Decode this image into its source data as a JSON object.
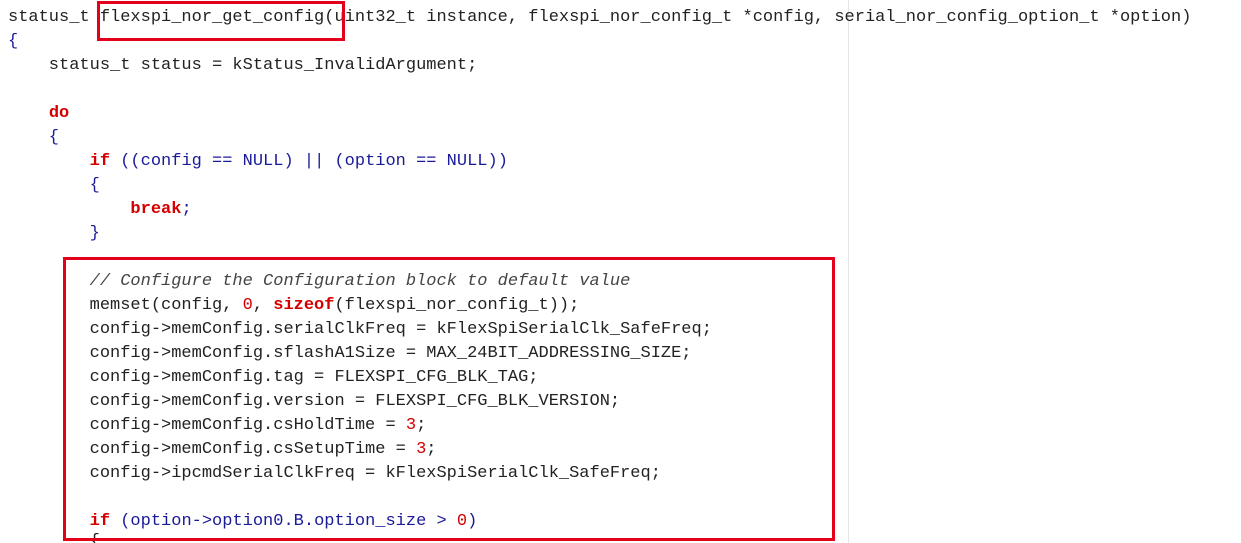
{
  "editor": {
    "clipped_top_line": "// ...",
    "clipped_bottom_line": "        {",
    "lines": [
      [
        {
          "t": "status_t flexspi_nor_get_config(uint32_t instance, flexspi_nor_config_t *config, serial_nor_config_option_t *option)",
          "c": "pl"
        }
      ],
      [
        {
          "t": "{",
          "c": "op"
        }
      ],
      [
        {
          "t": "    status_t status = kStatus_InvalidArgument;",
          "c": "pl"
        }
      ],
      [],
      [
        {
          "t": "    ",
          "c": "pl"
        },
        {
          "t": "do",
          "c": "kw"
        }
      ],
      [
        {
          "t": "    {",
          "c": "op"
        }
      ],
      [
        {
          "t": "        ",
          "c": "pl"
        },
        {
          "t": "if",
          "c": "kw"
        },
        {
          "t": " ((config == NULL) || (option == NULL))",
          "c": "op"
        }
      ],
      [
        {
          "t": "        {",
          "c": "op"
        }
      ],
      [
        {
          "t": "            ",
          "c": "pl"
        },
        {
          "t": "break",
          "c": "kw"
        },
        {
          "t": ";",
          "c": "op"
        }
      ],
      [
        {
          "t": "        }",
          "c": "op"
        }
      ],
      [],
      [
        {
          "t": "        // Configure the Configuration block to default value",
          "c": "cm"
        }
      ],
      [
        {
          "t": "        memset(config, ",
          "c": "pl"
        },
        {
          "t": "0",
          "c": "num"
        },
        {
          "t": ", ",
          "c": "pl"
        },
        {
          "t": "sizeof",
          "c": "kw"
        },
        {
          "t": "(flexspi_nor_config_t));",
          "c": "pl"
        }
      ],
      [
        {
          "t": "        config->memConfig.serialClkFreq = kFlexSpiSerialClk_SafeFreq;",
          "c": "pl"
        }
      ],
      [
        {
          "t": "        config->memConfig.sflashA1Size = MAX_24BIT_ADDRESSING_SIZE;",
          "c": "pl"
        }
      ],
      [
        {
          "t": "        config->memConfig.tag = FLEXSPI_CFG_BLK_TAG;",
          "c": "pl"
        }
      ],
      [
        {
          "t": "        config->memConfig.version = FLEXSPI_CFG_BLK_VERSION;",
          "c": "pl"
        }
      ],
      [
        {
          "t": "        config->memConfig.csHoldTime = ",
          "c": "pl"
        },
        {
          "t": "3",
          "c": "num"
        },
        {
          "t": ";",
          "c": "pl"
        }
      ],
      [
        {
          "t": "        config->memConfig.csSetupTime = ",
          "c": "pl"
        },
        {
          "t": "3",
          "c": "num"
        },
        {
          "t": ";",
          "c": "pl"
        }
      ],
      [
        {
          "t": "        config->ipcmdSerialClkFreq = kFlexSpiSerialClk_SafeFreq;",
          "c": "pl"
        }
      ],
      [],
      [
        {
          "t": "        ",
          "c": "pl"
        },
        {
          "t": "if",
          "c": "kw"
        },
        {
          "t": " (option->option0.B.option_size > ",
          "c": "op"
        },
        {
          "t": "0",
          "c": "num"
        },
        {
          "t": ")",
          "c": "op"
        }
      ]
    ]
  },
  "colors": {
    "keyword": "#d40000",
    "highlight_box": "#e3001b",
    "comment": "#444444",
    "operator": "#1a1a99"
  }
}
